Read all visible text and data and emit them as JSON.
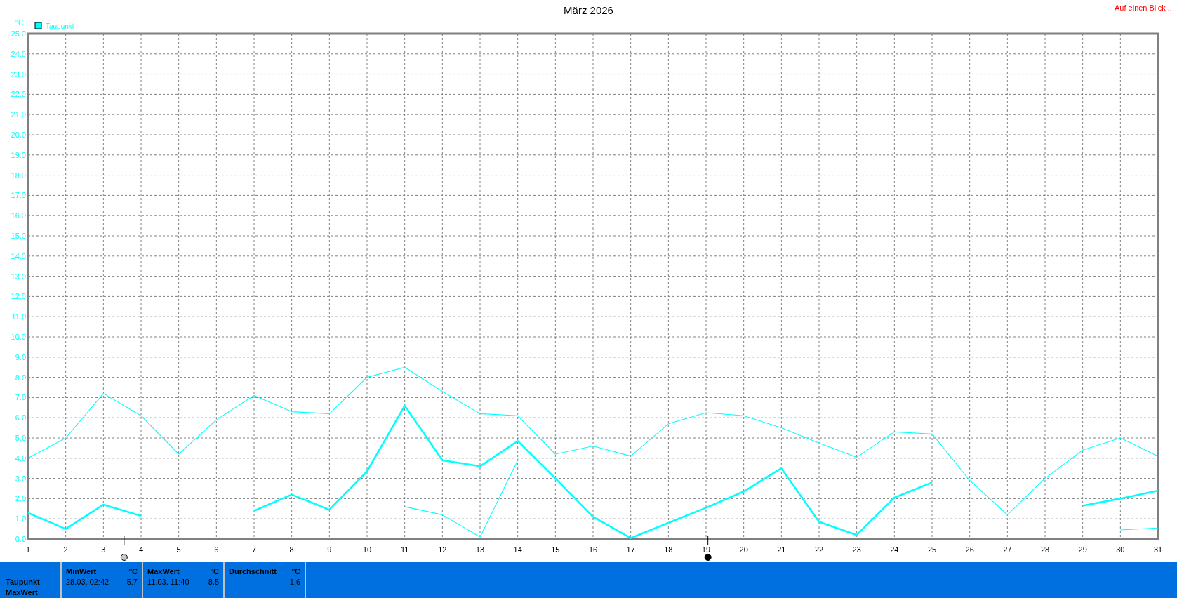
{
  "header": {
    "title": "März 2026",
    "link": "Auf einen Blick ..."
  },
  "chart": {
    "unit": "°C",
    "legend": [
      {
        "label": "Taupunkt",
        "color": "#00ffff"
      }
    ],
    "chart_data": {
      "type": "line",
      "x": [
        1,
        2,
        3,
        4,
        5,
        6,
        7,
        8,
        9,
        10,
        11,
        12,
        13,
        14,
        15,
        16,
        17,
        18,
        19,
        20,
        21,
        22,
        23,
        24,
        25,
        26,
        27,
        28,
        29,
        30,
        31
      ],
      "series": [
        {
          "color": "#00ffff",
          "values": [
            4.0,
            5.0,
            7.2,
            6.1,
            4.2,
            5.9,
            7.1,
            6.3,
            6.2,
            8.0,
            8.5,
            7.3,
            6.2,
            6.1,
            4.2,
            4.6,
            4.1,
            5.7,
            6.25,
            6.1,
            5.5,
            4.75,
            4.05,
            5.3,
            5.2,
            2.9,
            1.2,
            3.0,
            4.4,
            5.0,
            4.1
          ]
        },
        {
          "color": "#00ffff",
          "values": [
            1.3,
            0.5,
            1.7,
            1.15,
            null,
            null,
            1.4,
            2.2,
            1.45,
            3.35,
            6.6,
            3.9,
            3.6,
            4.85,
            3.0,
            1.1,
            0.05,
            0.8,
            1.55,
            2.35,
            3.5,
            0.85,
            0.2,
            2.05,
            2.8,
            null,
            null,
            null,
            1.65,
            2.0,
            2.4
          ]
        },
        {
          "color": "#00ffff",
          "values": [
            null,
            null,
            null,
            null,
            null,
            null,
            null,
            null,
            null,
            null,
            1.6,
            1.2,
            0.1,
            3.9,
            null,
            null,
            null,
            null,
            null,
            null,
            null,
            null,
            null,
            null,
            null,
            null,
            null,
            null,
            null,
            0.45,
            0.55
          ]
        }
      ],
      "grid": true,
      "ylim": [
        0,
        25
      ],
      "xlim": [
        1,
        31
      ],
      "yticks": [
        {
          "value": 0,
          "label": "0.0"
        },
        {
          "value": 1,
          "label": "1.0"
        },
        {
          "value": 2,
          "label": "2.0"
        },
        {
          "value": 3,
          "label": "3.0"
        },
        {
          "value": 4,
          "label": "4.0"
        },
        {
          "value": 5,
          "label": "5.0"
        },
        {
          "value": 6,
          "label": "6.0"
        },
        {
          "value": 7,
          "label": "7.0"
        },
        {
          "value": 8,
          "label": "8.0"
        },
        {
          "value": 9,
          "label": "9.0"
        },
        {
          "value": 10,
          "label": "10.0"
        },
        {
          "value": 11,
          "label": "11.0"
        },
        {
          "value": 12,
          "label": "12.0"
        },
        {
          "value": 13,
          "label": "13.0"
        },
        {
          "value": 14,
          "label": "14.0"
        },
        {
          "value": 15,
          "label": "15.0"
        },
        {
          "value": 16,
          "label": "16.0"
        },
        {
          "value": 17,
          "label": "17.0"
        },
        {
          "value": 18,
          "label": "18.0"
        },
        {
          "value": 19,
          "label": "19.0"
        },
        {
          "value": 20,
          "label": "20.0"
        },
        {
          "value": 21,
          "label": "21.0"
        },
        {
          "value": 22,
          "label": "22.0"
        },
        {
          "value": 23,
          "label": "23.0"
        },
        {
          "value": 24,
          "label": "24.0"
        },
        {
          "value": 25,
          "label": "25.0"
        }
      ],
      "xticks": [
        1,
        2,
        3,
        4,
        5,
        6,
        7,
        8,
        9,
        10,
        11,
        12,
        13,
        14,
        15,
        16,
        17,
        18,
        19,
        20,
        21,
        22,
        23,
        24,
        25,
        26,
        27,
        28,
        29,
        30,
        31
      ]
    },
    "lines": [
      {
        "kind": "thin"
      },
      {
        "kind": "thick"
      },
      {
        "kind": "thin"
      }
    ],
    "moon_markers": [
      {
        "kind": "light"
      },
      {
        "kind": "dark"
      }
    ]
  },
  "stats": {
    "row_labels": [
      "Taupunkt",
      "MaxWert"
    ],
    "columns": [
      {
        "title": "MinWert",
        "unit": "°C",
        "time": "28.03.  02:42",
        "value": "-5.7"
      },
      {
        "title": "MaxWert",
        "unit": "°C",
        "time": "11.03.  11:40",
        "value": "8.5"
      },
      {
        "title": "Durchschnitt",
        "unit": "°C",
        "value": "1.6"
      }
    ]
  }
}
